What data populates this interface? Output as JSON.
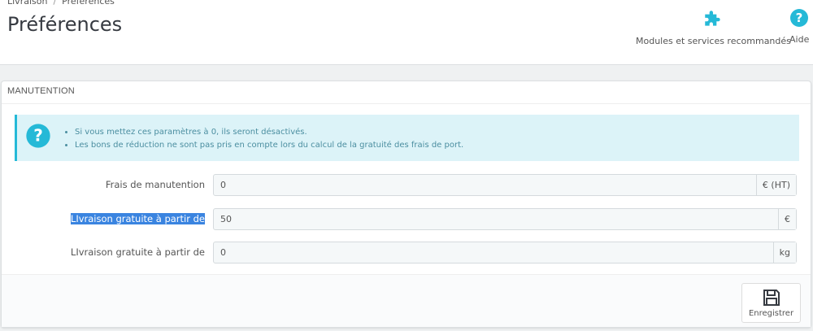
{
  "breadcrumb": {
    "parent": "Livraison",
    "separator": "/",
    "current": "Préférences"
  },
  "page_title": "Préférences",
  "toolbar": {
    "modules_label": "Modules et services recommandés",
    "help_label": "Aide"
  },
  "panel": {
    "title": "Manutention",
    "alert_items": [
      "Si vous mettez ces paramètres à 0, ils seront désactivés.",
      "Les bons de réduction ne sont pas pris en compte lors du calcul de la gratuité des frais de port."
    ],
    "fields": [
      {
        "label": "Frais de manutention",
        "value": "0",
        "addon": "€ (HT)"
      },
      {
        "label": "LIvraison gratuite à partir de",
        "value": "50",
        "addon": "€"
      },
      {
        "label": "LIvraison gratuite à partir de",
        "value": "0",
        "addon": "kg"
      }
    ],
    "save_label": "Enregistrer"
  },
  "colors": {
    "accent": "#25b9d7",
    "alert_bg": "#dcf3f8",
    "selection": "#3a84e0"
  }
}
